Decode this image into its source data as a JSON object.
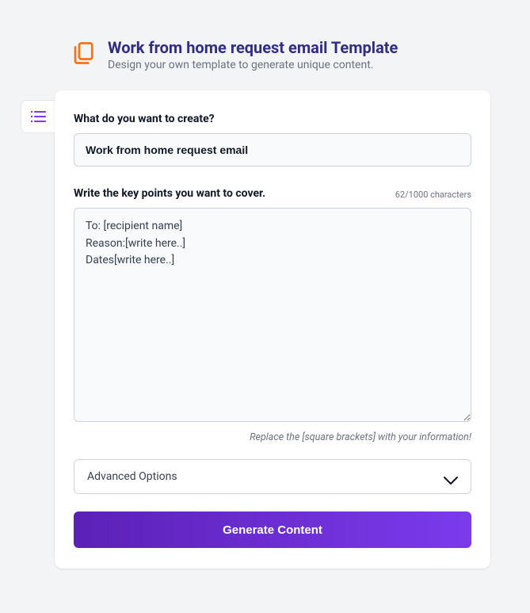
{
  "header": {
    "title": "Work from home request email Template",
    "subtitle": "Design your own template to generate unique content."
  },
  "form": {
    "create": {
      "label": "What do you want to create?",
      "value": "Work from home request email"
    },
    "keypoints": {
      "label": "Write the key points you want to cover.",
      "count_text": "62/1000 characters",
      "value": "To: [recipient name]\nReason:[write here..]\nDates[write here..]",
      "hint": "Replace the [square brackets] with your information!"
    },
    "advanced_label": "Advanced Options",
    "generate_label": "Generate Content"
  }
}
